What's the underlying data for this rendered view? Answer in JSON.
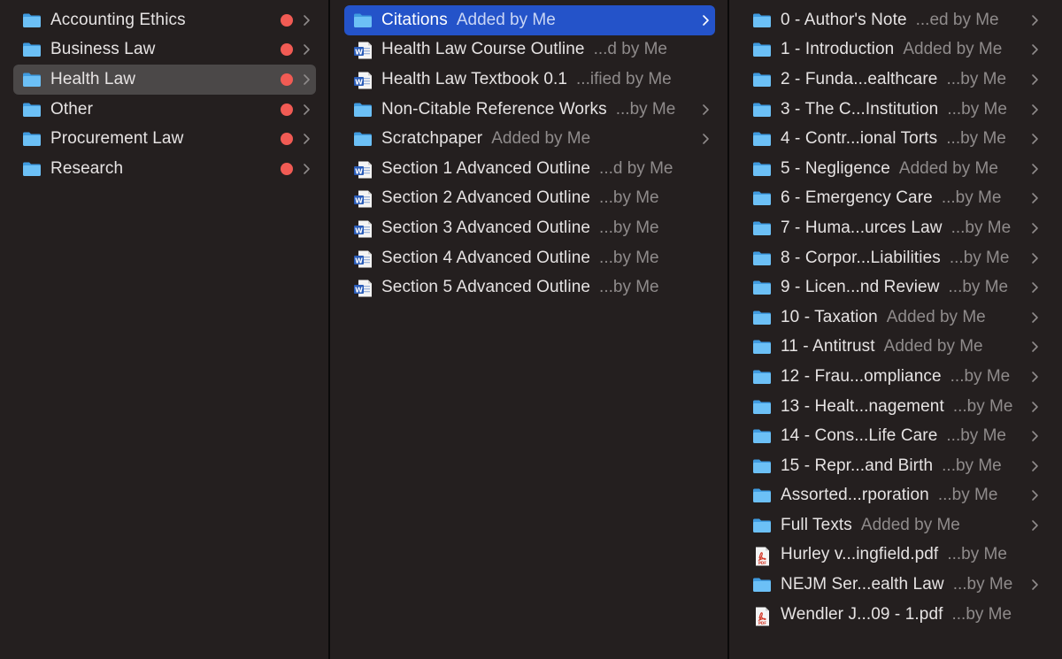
{
  "column1": {
    "items": [
      {
        "name": "Accounting Ethics",
        "icon": "folder-icon",
        "tag": "red",
        "has_children": true,
        "selected": false
      },
      {
        "name": "Business Law",
        "icon": "folder-icon",
        "tag": "red",
        "has_children": true,
        "selected": false
      },
      {
        "name": "Health Law",
        "icon": "folder-icon",
        "tag": "red",
        "has_children": true,
        "selected": true
      },
      {
        "name": "Other",
        "icon": "folder-icon",
        "tag": "red",
        "has_children": true,
        "selected": false
      },
      {
        "name": "Procurement Law",
        "icon": "folder-icon",
        "tag": "red",
        "has_children": true,
        "selected": false
      },
      {
        "name": "Research",
        "icon": "folder-icon",
        "tag": "red",
        "has_children": true,
        "selected": false
      }
    ]
  },
  "column2": {
    "items": [
      {
        "name": "Citations",
        "meta": "Added by Me",
        "icon": "folder-icon",
        "has_children": true,
        "selected": true
      },
      {
        "name": "Health Law Course Outline",
        "meta": "...d by Me",
        "icon": "word-document-icon",
        "has_children": false,
        "selected": false
      },
      {
        "name": "Health Law Textbook 0.1",
        "meta": "...ified by Me",
        "icon": "word-document-icon",
        "has_children": false,
        "selected": false
      },
      {
        "name": "Non-Citable Reference Works",
        "meta": "...by Me",
        "icon": "folder-icon",
        "has_children": true,
        "selected": false
      },
      {
        "name": "Scratchpaper",
        "meta": "Added by Me",
        "icon": "folder-icon",
        "has_children": true,
        "selected": false
      },
      {
        "name": "Section 1 Advanced Outline",
        "meta": "...d by Me",
        "icon": "word-document-icon",
        "has_children": false,
        "selected": false
      },
      {
        "name": "Section 2 Advanced Outline",
        "meta": "...by Me",
        "icon": "word-document-icon",
        "has_children": false,
        "selected": false
      },
      {
        "name": "Section 3 Advanced Outline",
        "meta": "...by Me",
        "icon": "word-document-icon",
        "has_children": false,
        "selected": false
      },
      {
        "name": "Section 4 Advanced Outline",
        "meta": "...by Me",
        "icon": "word-document-icon",
        "has_children": false,
        "selected": false
      },
      {
        "name": "Section 5 Advanced Outline",
        "meta": "...by Me",
        "icon": "word-document-icon",
        "has_children": false,
        "selected": false
      }
    ]
  },
  "column3": {
    "items": [
      {
        "name": "0 - Author's Note",
        "meta": "...ed by Me",
        "icon": "folder-icon",
        "has_children": true
      },
      {
        "name": "1 - Introduction",
        "meta": "Added by Me",
        "icon": "folder-icon",
        "has_children": true
      },
      {
        "name": "2 - Funda...ealthcare",
        "meta": "...by Me",
        "icon": "folder-icon",
        "has_children": true
      },
      {
        "name": "3 - The C...Institution",
        "meta": "...by Me",
        "icon": "folder-icon",
        "has_children": true
      },
      {
        "name": "4 - Contr...ional Torts",
        "meta": "...by Me",
        "icon": "folder-icon",
        "has_children": true
      },
      {
        "name": "5 - Negligence",
        "meta": "Added by Me",
        "icon": "folder-icon",
        "has_children": true
      },
      {
        "name": "6 - Emergency Care",
        "meta": "...by Me",
        "icon": "folder-icon",
        "has_children": true
      },
      {
        "name": "7 - Huma...urces Law",
        "meta": "...by Me",
        "icon": "folder-icon",
        "has_children": true
      },
      {
        "name": "8 - Corpor...Liabilities",
        "meta": "...by Me",
        "icon": "folder-icon",
        "has_children": true
      },
      {
        "name": "9 - Licen...nd Review",
        "meta": "...by Me",
        "icon": "folder-icon",
        "has_children": true
      },
      {
        "name": "10 - Taxation",
        "meta": "Added by Me",
        "icon": "folder-icon",
        "has_children": true
      },
      {
        "name": "11 - Antitrust",
        "meta": "Added by Me",
        "icon": "folder-icon",
        "has_children": true
      },
      {
        "name": "12 - Frau...ompliance",
        "meta": "...by Me",
        "icon": "folder-icon",
        "has_children": true
      },
      {
        "name": "13 - Healt...nagement",
        "meta": "...by Me",
        "icon": "folder-icon",
        "has_children": true
      },
      {
        "name": "14 - Cons...Life Care",
        "meta": "...by Me",
        "icon": "folder-icon",
        "has_children": true
      },
      {
        "name": "15 - Repr...and Birth",
        "meta": "...by Me",
        "icon": "folder-icon",
        "has_children": true
      },
      {
        "name": "Assorted...rporation",
        "meta": "...by Me",
        "icon": "folder-icon",
        "has_children": true
      },
      {
        "name": "Full Texts",
        "meta": "Added by Me",
        "icon": "folder-icon",
        "has_children": true
      },
      {
        "name": "Hurley v...ingfield.pdf",
        "meta": "...by Me",
        "icon": "pdf-icon",
        "has_children": false
      },
      {
        "name": "NEJM Ser...ealth Law",
        "meta": "...by Me",
        "icon": "folder-icon",
        "has_children": true
      },
      {
        "name": "Wendler J...09 - 1.pdf",
        "meta": "...by Me",
        "icon": "pdf-icon",
        "has_children": false
      }
    ]
  },
  "colors": {
    "background": "#241f1f",
    "separator": "#0a0909",
    "selected_active": "#2453c9",
    "selected_inactive": "#4b4848",
    "text": "#e6e3e3",
    "meta_text": "#8f8b8b",
    "tag_red": "#f15b54",
    "folder_blue": "#5fb4f0"
  }
}
